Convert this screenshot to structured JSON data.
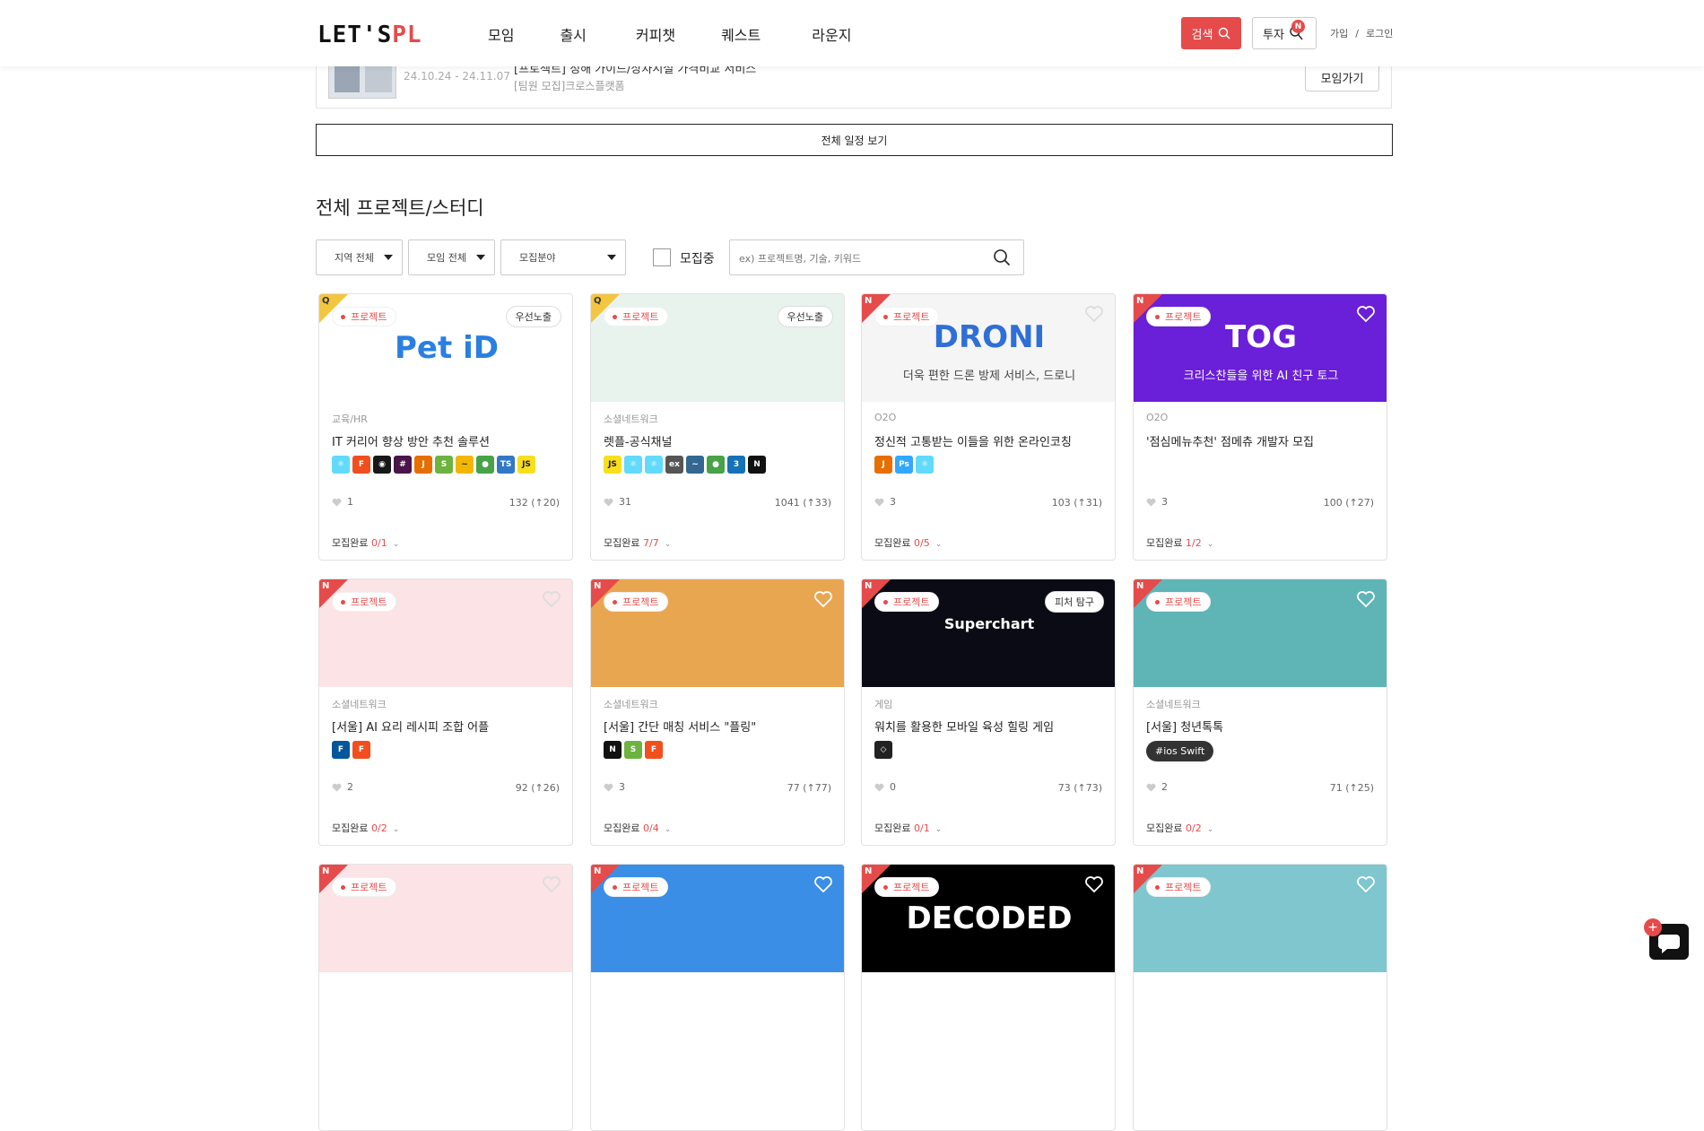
{
  "header": {
    "logo_main": "LET'S",
    "logo_accent": "PL",
    "nav": [
      "모임",
      "출시",
      "커피챗",
      "퀘스트",
      "라운지"
    ],
    "search_label": "검색",
    "invest_label": "투자",
    "invest_badge": "N",
    "signup": "가입",
    "separator": "/",
    "login": "로그인"
  },
  "schedule": {
    "date_range": "24.10.24 - 24.11.07",
    "title": "[프로젝트] 정해 가이드/상차시설 가격비교 서비스",
    "subtitle": "[팀원 모집]크로스플랫폼",
    "join_label": "모임가기",
    "view_all_label": "전체 일정 보기"
  },
  "section": {
    "title": "전체 프로젝트/스터디"
  },
  "filters": {
    "region": "지역 전체",
    "meeting": "모임 전체",
    "field": "모집분야",
    "recruiting_label": "모집중",
    "search_placeholder": "ex) 프로젝트명, 기술, 키워드"
  },
  "cards": [
    {
      "corner": "Q",
      "type": "프로젝트",
      "promo": "우선노출",
      "category": "교육/HR",
      "title": "IT 커리어 향상 방안 추천 솔루션",
      "likes": "1",
      "views": "132 (↑20)",
      "status_label": "모집완료",
      "status_count": "0/1",
      "banner_text": "Pet iD",
      "banner_bg": "#ffffff",
      "banner_fg": "#2a7fe0",
      "stack": [
        {
          "t": "⚛",
          "c": "#61dafb"
        },
        {
          "t": "F",
          "c": "#f24e1e"
        },
        {
          "t": "◉",
          "c": "#181717"
        },
        {
          "t": "#",
          "c": "#4a154b"
        },
        {
          "t": "J",
          "c": "#e76f00"
        },
        {
          "t": "S",
          "c": "#6db33f"
        },
        {
          "t": "~",
          "c": "#f2b600"
        },
        {
          "t": "●",
          "c": "#47a248"
        },
        {
          "t": "TS",
          "c": "#3178c6"
        },
        {
          "t": "JS",
          "c": "#f7df1e"
        }
      ]
    },
    {
      "corner": "Q",
      "type": "프로젝트",
      "promo": "우선노출",
      "category": "소셜네트워크",
      "title": "렛플-공식채널",
      "likes": "31",
      "views": "1041 (↑33)",
      "status_label": "모집완료",
      "status_count": "7/7",
      "banner_text": "",
      "banner_bg": "#e8f3ee",
      "banner_fg": "#3aa57a",
      "stack": [
        {
          "t": "JS",
          "c": "#f7df1e"
        },
        {
          "t": "⚛",
          "c": "#61dafb"
        },
        {
          "t": "⚛",
          "c": "#61dafb"
        },
        {
          "t": "ex",
          "c": "#555555"
        },
        {
          "t": "~",
          "c": "#336791"
        },
        {
          "t": "●",
          "c": "#47a248"
        },
        {
          "t": "3",
          "c": "#1572b6"
        },
        {
          "t": "N",
          "c": "#111111"
        }
      ]
    },
    {
      "corner": "N",
      "type": "프로젝트",
      "promo": "",
      "category": "O2O",
      "title": "정신적 고통받는 이들을 위한 온라인코칭",
      "likes": "3",
      "views": "103 (↑31)",
      "status_label": "모집완료",
      "status_count": "0/5",
      "banner_text": "DRONI",
      "banner_sub": "더욱 편한 드론 방제 서비스, 드로니",
      "banner_bg": "#f5f5f5",
      "banner_fg": "#2f6fd6",
      "stack": [
        {
          "t": "J",
          "c": "#e76f00"
        },
        {
          "t": "Ps",
          "c": "#31a8ff"
        },
        {
          "t": "⚛",
          "c": "#61dafb"
        }
      ]
    },
    {
      "corner": "N",
      "type": "프로젝트",
      "promo": "",
      "category": "O2O",
      "title": "'점심메뉴추천' 점메츄 개발자 모집",
      "likes": "3",
      "views": "100 (↑27)",
      "status_label": "모집완료",
      "status_count": "1/2",
      "banner_text": "TOG",
      "banner_sub": "크리스찬들을 위한 AI 친구 토그",
      "banner_bg": "#6a1fd8",
      "banner_fg": "#ffffff",
      "stack": []
    },
    {
      "corner": "N",
      "type": "프로젝트",
      "promo": "",
      "category": "소셜네트워크",
      "title": "[서울] AI 요리 레시피 조합 어플",
      "likes": "2",
      "views": "92 (↑26)",
      "status_label": "모집완료",
      "status_count": "0/2",
      "banner_text": "",
      "banner_bg": "#fbe3e6",
      "banner_fg": "#e64b4b",
      "stack": [
        {
          "t": "F",
          "c": "#02569b"
        },
        {
          "t": "F",
          "c": "#f24e1e"
        }
      ]
    },
    {
      "corner": "N",
      "type": "프로젝트",
      "promo": "",
      "category": "소셜네트워크",
      "title": "[서울] 간단 매칭 서비스 \"플링\"",
      "likes": "3",
      "views": "77 (↑77)",
      "status_label": "모집완료",
      "status_count": "0/4",
      "banner_text": "",
      "banner_bg": "#e9a650",
      "banner_fg": "#ffffff",
      "stack": [
        {
          "t": "N",
          "c": "#111111"
        },
        {
          "t": "S",
          "c": "#6db33f"
        },
        {
          "t": "F",
          "c": "#f24e1e"
        }
      ]
    },
    {
      "corner": "N",
      "type": "프로젝트",
      "promo": "피처 탐구",
      "category": "게임",
      "title": "워치를 활용한 모바일 육성 힐링 게임",
      "likes": "0",
      "views": "73 (↑73)",
      "status_label": "모집완료",
      "status_count": "0/1",
      "banner_text": "Superchart",
      "banner_bg": "#0b0b16",
      "banner_fg": "#ffffff",
      "stack": [
        {
          "t": "◇",
          "c": "#222222"
        }
      ]
    },
    {
      "corner": "N",
      "type": "프로젝트",
      "promo": "",
      "category": "소셜네트워크",
      "title": "[서울] 청년톡톡",
      "likes": "2",
      "views": "71 (↑25)",
      "status_label": "모집완료",
      "status_count": "0/2",
      "banner_text": "",
      "banner_bg": "#5fb4b6",
      "banner_fg": "#ffffff",
      "tag": "#ios Swift",
      "stack": []
    },
    {
      "corner": "N",
      "type": "프로젝트",
      "promo": "",
      "category": "",
      "title": "",
      "likes": "",
      "views": "",
      "status_label": "",
      "status_count": "",
      "banner_text": "",
      "banner_bg": "#fbe3e6",
      "banner_fg": "#e64b4b",
      "stack": []
    },
    {
      "corner": "N",
      "type": "프로젝트",
      "promo": "",
      "category": "",
      "title": "",
      "likes": "",
      "views": "",
      "status_label": "",
      "status_count": "",
      "banner_text": "",
      "banner_bg": "#3a8ee6",
      "banner_fg": "#ffffff",
      "stack": []
    },
    {
      "corner": "N",
      "type": "프로젝트",
      "promo": "",
      "category": "",
      "title": "",
      "likes": "",
      "views": "",
      "status_label": "",
      "status_count": "",
      "banner_text": "DECODED",
      "banner_bg": "#000000",
      "banner_fg": "#ffffff",
      "stack": []
    },
    {
      "corner": "N",
      "type": "프로젝트",
      "promo": "",
      "category": "",
      "title": "",
      "likes": "",
      "views": "",
      "status_label": "",
      "status_count": "",
      "banner_text": "",
      "banner_bg": "#7fc6cf",
      "banner_fg": "#ffffff",
      "stack": []
    }
  ],
  "chat": {
    "plus": "+"
  },
  "colors": {
    "accent": "#e64b4b",
    "text": "#222222",
    "muted": "#999999"
  }
}
